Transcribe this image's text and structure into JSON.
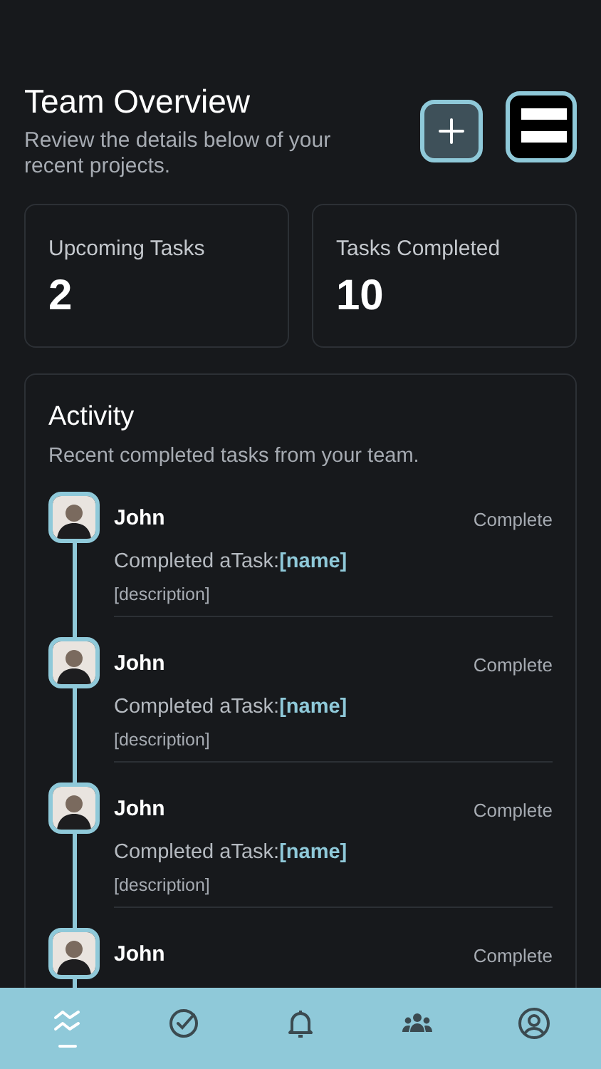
{
  "header": {
    "title": "Team Overview",
    "subtitle": "Review the details below of your recent projects."
  },
  "stats": [
    {
      "label": "Upcoming Tasks",
      "value": "2"
    },
    {
      "label": "Tasks Completed",
      "value": "10"
    }
  ],
  "activity": {
    "title": "Activity",
    "subtitle": "Recent completed tasks from your team.",
    "items": [
      {
        "name": "John",
        "status": "Complete",
        "text": "Completed aTask:**[name]**",
        "description": "[description]"
      },
      {
        "name": "John",
        "status": "Complete",
        "text": "Completed aTask:**[name]**",
        "description": "[description]"
      },
      {
        "name": "John",
        "status": "Complete",
        "text": "Completed aTask:**[name]**",
        "description": "[description]"
      },
      {
        "name": "John",
        "status": "Complete"
      }
    ]
  },
  "nav": [
    {
      "kind": "overview",
      "selected": true
    },
    {
      "kind": "tasks",
      "selected": false
    },
    {
      "kind": "notifications",
      "selected": false
    },
    {
      "kind": "team",
      "selected": false
    },
    {
      "kind": "profile",
      "selected": false
    }
  ]
}
